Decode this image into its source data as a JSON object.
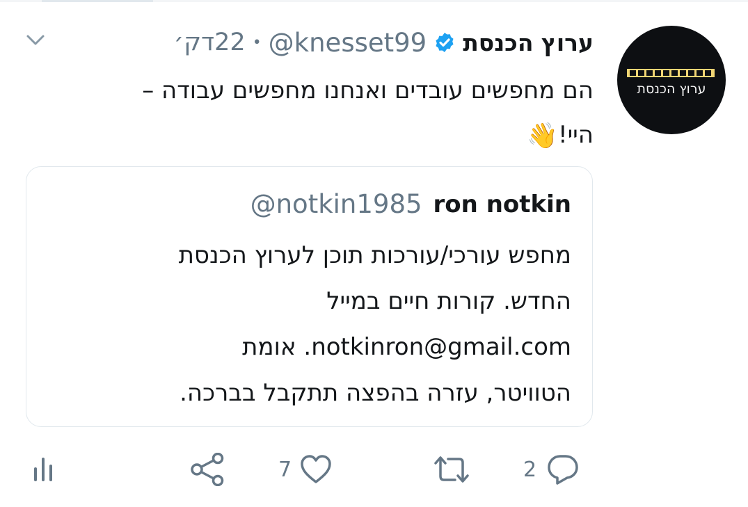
{
  "author": {
    "display_name": "ערוץ הכנסת",
    "handle": "@knesset99",
    "separator": "•",
    "time": "22דק׳",
    "avatar_text": "ערוץ הכנסת"
  },
  "tweet": {
    "line1": "הם מחפשים עובדים ואנחנו מחפשים עבודה –",
    "line2": "היי!",
    "emoji": "👋"
  },
  "quote": {
    "name": "ron notkin",
    "handle": "@notkin1985",
    "lines": [
      "מחפש עורכי/עורכות תוכן לערוץ הכנסת",
      "החדש. קורות חיים במייל",
      "notkinron@gmail.com. אומת",
      "הטוויטר, עזרה בהפצה תתקבל בברכה."
    ]
  },
  "actions": {
    "reply_count": "2",
    "retweet_count": "",
    "like_count": "7",
    "icons": [
      "analytics-icon",
      "share-icon",
      "heart-icon",
      "retweet-icon",
      "reply-icon"
    ]
  },
  "colors": {
    "text": "#14171a",
    "muted": "#657786",
    "verified": "#1da1f2",
    "border": "#e1e8ed"
  }
}
